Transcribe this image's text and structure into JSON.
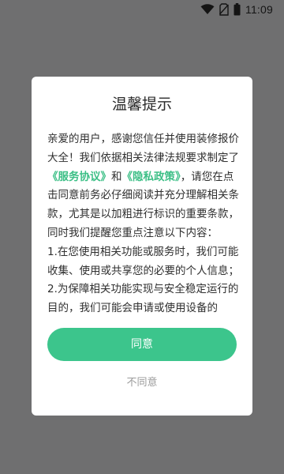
{
  "status_bar": {
    "time": "11:09",
    "icons": [
      "wifi-icon",
      "no-sim-icon",
      "battery-icon"
    ]
  },
  "dialog": {
    "title": "温馨提示",
    "body": {
      "intro_before_links": "亲爱的用户，感谢您信任并使用装修报价大全！我们依据相关法律法规要求制定了",
      "service_link": "《服务协议》",
      "conjunction": "和",
      "privacy_link": "《隐私政策》",
      "intro_after_links": "，请您在点击同意前务必仔细阅读并充分理解相关条款，尤其是以加粗进行标识的重要条款，同时我们提醒您重点注意以下内容：",
      "item1": "1.在您使用相关功能或服务时，我们可能收集、使用或共享您的必要的个人信息；",
      "item2": "2.为保障相关功能实现与安全稳定运行的目的，我们可能会申请或使用设备的"
    },
    "agree_label": "同意",
    "disagree_label": "不同意"
  },
  "colors": {
    "accent": "#3cc58c",
    "link": "#3cbf86",
    "overlay": "#6f6f70"
  }
}
